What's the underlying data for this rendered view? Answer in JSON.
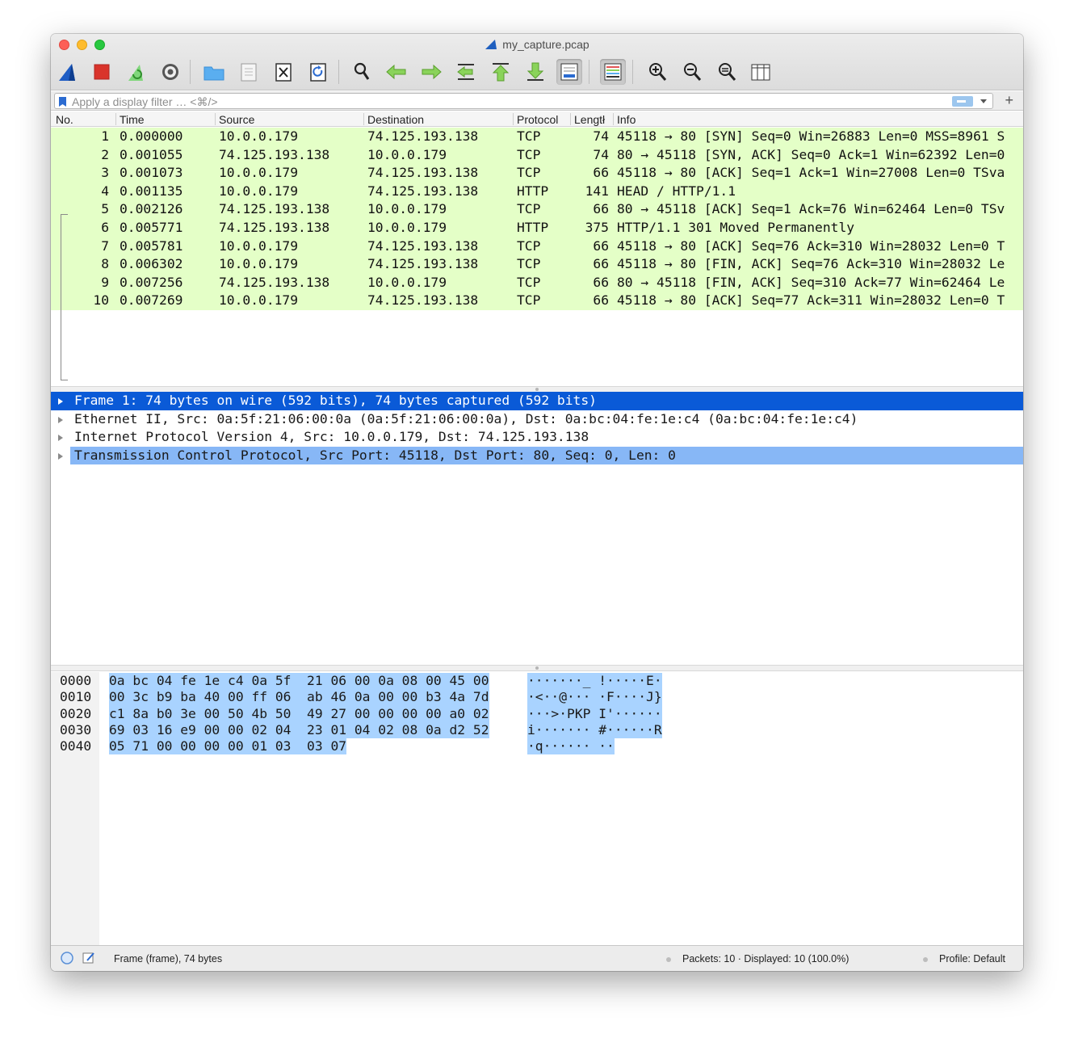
{
  "window": {
    "title": "my_capture.pcap"
  },
  "toolbar": {
    "buttons": [
      "start-capture-icon",
      "stop-capture-icon",
      "restart-capture-icon",
      "capture-options-icon",
      "open-file-icon",
      "save-file-icon",
      "close-file-icon",
      "reload-file-icon",
      "find-packet-icon",
      "go-back-icon",
      "go-forward-icon",
      "go-to-packet-icon",
      "first-packet-icon",
      "last-packet-icon",
      "autoscroll-icon",
      "colorize-icon",
      "zoom-in-icon",
      "zoom-out-icon",
      "normal-size-icon",
      "resize-columns-icon"
    ]
  },
  "filter": {
    "placeholder": "Apply a display filter … <⌘/>",
    "value": ""
  },
  "packet_list": {
    "columns": [
      "No.",
      "Time",
      "Source",
      "Destination",
      "Protocol",
      "Length",
      "Info"
    ],
    "header_labels": {
      "no": "No.",
      "time": "Time",
      "source": "Source",
      "destination": "Destination",
      "protocol": "Protocol",
      "length": "Lengtł",
      "info": "Info"
    },
    "row_color": "#e4ffc7",
    "rows": [
      {
        "no": "1",
        "time": "0.000000",
        "source": "10.0.0.179",
        "destination": "74.125.193.138",
        "protocol": "TCP",
        "length": "74",
        "info": "45118 → 80 [SYN] Seq=0 Win=26883 Len=0 MSS=8961 S"
      },
      {
        "no": "2",
        "time": "0.001055",
        "source": "74.125.193.138",
        "destination": "10.0.0.179",
        "protocol": "TCP",
        "length": "74",
        "info": "80 → 45118 [SYN, ACK] Seq=0 Ack=1 Win=62392 Len=0"
      },
      {
        "no": "3",
        "time": "0.001073",
        "source": "10.0.0.179",
        "destination": "74.125.193.138",
        "protocol": "TCP",
        "length": "66",
        "info": "45118 → 80 [ACK] Seq=1 Ack=1 Win=27008 Len=0 TSva"
      },
      {
        "no": "4",
        "time": "0.001135",
        "source": "10.0.0.179",
        "destination": "74.125.193.138",
        "protocol": "HTTP",
        "length": "141",
        "info": "HEAD / HTTP/1.1"
      },
      {
        "no": "5",
        "time": "0.002126",
        "source": "74.125.193.138",
        "destination": "10.0.0.179",
        "protocol": "TCP",
        "length": "66",
        "info": "80 → 45118 [ACK] Seq=1 Ack=76 Win=62464 Len=0 TSv"
      },
      {
        "no": "6",
        "time": "0.005771",
        "source": "74.125.193.138",
        "destination": "10.0.0.179",
        "protocol": "HTTP",
        "length": "375",
        "info": "HTTP/1.1 301 Moved Permanently"
      },
      {
        "no": "7",
        "time": "0.005781",
        "source": "10.0.0.179",
        "destination": "74.125.193.138",
        "protocol": "TCP",
        "length": "66",
        "info": "45118 → 80 [ACK] Seq=76 Ack=310 Win=28032 Len=0 T"
      },
      {
        "no": "8",
        "time": "0.006302",
        "source": "10.0.0.179",
        "destination": "74.125.193.138",
        "protocol": "TCP",
        "length": "66",
        "info": "45118 → 80 [FIN, ACK] Seq=76 Ack=310 Win=28032 Le"
      },
      {
        "no": "9",
        "time": "0.007256",
        "source": "74.125.193.138",
        "destination": "10.0.0.179",
        "protocol": "TCP",
        "length": "66",
        "info": "80 → 45118 [FIN, ACK] Seq=310 Ack=77 Win=62464 Le"
      },
      {
        "no": "10",
        "time": "0.007269",
        "source": "10.0.0.179",
        "destination": "74.125.193.138",
        "protocol": "TCP",
        "length": "66",
        "info": "45118 → 80 [ACK] Seq=77 Ack=311 Win=28032 Len=0 T"
      }
    ]
  },
  "details": {
    "rows": [
      {
        "text": "Frame 1: 74 bytes on wire (592 bits), 74 bytes captured (592 bits)",
        "state": "active"
      },
      {
        "text": "Ethernet II, Src: 0a:5f:21:06:00:0a (0a:5f:21:06:00:0a), Dst: 0a:bc:04:fe:1e:c4 (0a:bc:04:fe:1e:c4)",
        "state": "normal"
      },
      {
        "text": "Internet Protocol Version 4, Src: 10.0.0.179, Dst: 74.125.193.138",
        "state": "normal"
      },
      {
        "text": "Transmission Control Protocol, Src Port: 45118, Dst Port: 80, Seq: 0, Len: 0",
        "state": "hilite"
      }
    ],
    "active_color": "#0a5ad7",
    "hilite_color": "#87b7f6"
  },
  "bytes": {
    "rows": [
      {
        "offset": "0000",
        "hex": "0a bc 04 fe 1e c4 0a 5f  21 06 00 0a 08 00 45 00",
        "ascii": "·······_ !·····E·"
      },
      {
        "offset": "0010",
        "hex": "00 3c b9 ba 40 00 ff 06  ab 46 0a 00 00 b3 4a 7d",
        "ascii": "·<··@··· ·F····J}"
      },
      {
        "offset": "0020",
        "hex": "c1 8a b0 3e 00 50 4b 50  49 27 00 00 00 00 a0 02",
        "ascii": "···>·PKP I'······"
      },
      {
        "offset": "0030",
        "hex": "69 03 16 e9 00 00 02 04  23 01 04 02 08 0a d2 52",
        "ascii": "i······· #······R"
      },
      {
        "offset": "0040",
        "hex": "05 71 00 00 00 00 01 03  03 07",
        "ascii": "·q······ ··"
      }
    ],
    "highlight_color": "#a9d3ff"
  },
  "status": {
    "field": "Frame (frame), 74 bytes",
    "packets": "Packets: 10 · Displayed: 10 (100.0%)",
    "profile": "Profile: Default"
  }
}
